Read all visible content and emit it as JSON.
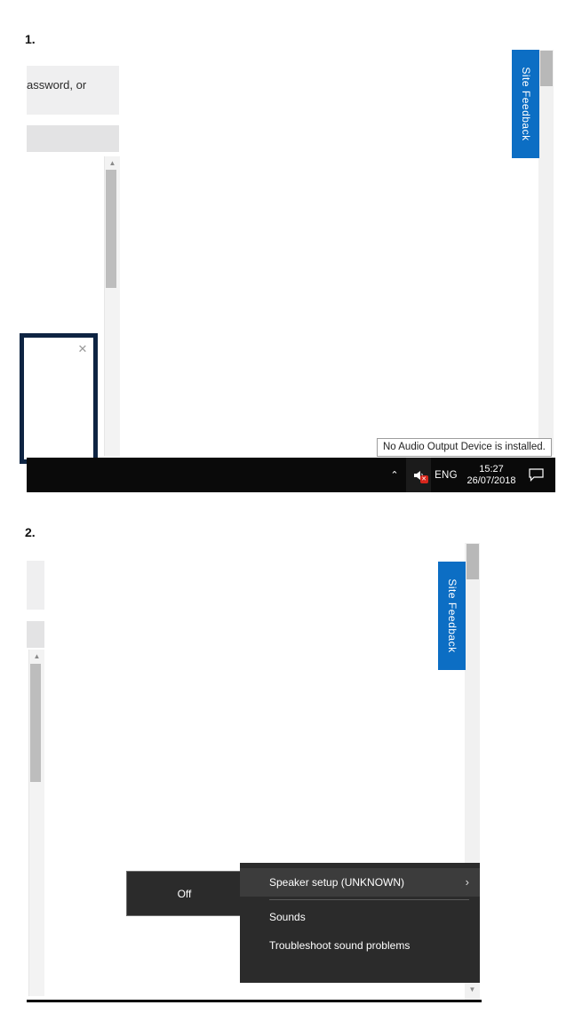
{
  "steps": [
    {
      "label": "1."
    },
    {
      "label": "2."
    }
  ],
  "colors": {
    "feedback_blue": "#0c6ec4",
    "taskbar_black": "#0a0a0a",
    "menu_dark": "#2b2b2b",
    "menu_highlight": "#3c3c3c",
    "dialog_navy": "#0e2442",
    "badge_red": "#d8261c"
  },
  "section1": {
    "panel_fragment_text": "assword, or",
    "site_feedback": {
      "label": "Site Feedback"
    },
    "dialog": {
      "close_icon": "close-icon",
      "close_glyph": "✕"
    },
    "scrollbar": {
      "up_arrow_glyph": "▲"
    },
    "tooltip": {
      "text": "No Audio Output Device is installed."
    },
    "taskbar": {
      "show_hidden_icons_glyph": "⌃",
      "volume_icon": "speaker-muted-icon",
      "volume_badge_glyph": "✕",
      "language": "ENG",
      "time": "15:27",
      "date": "26/07/2018",
      "action_center_icon": "action-center-icon"
    }
  },
  "section2": {
    "site_feedback": {
      "label": "Site Feedback"
    },
    "scrollbar": {
      "up_arrow_glyph": "▲",
      "down_arrow_glyph": "▼"
    },
    "off_tooltip": {
      "text": "Off"
    },
    "context_menu": {
      "items": [
        {
          "label": "Speaker setup (UNKNOWN)",
          "highlighted": true,
          "submenu_glyph": "›"
        },
        {
          "label": "Sounds",
          "highlighted": false,
          "submenu_glyph": ""
        },
        {
          "label": "Troubleshoot sound problems",
          "highlighted": false,
          "submenu_glyph": ""
        }
      ]
    }
  }
}
